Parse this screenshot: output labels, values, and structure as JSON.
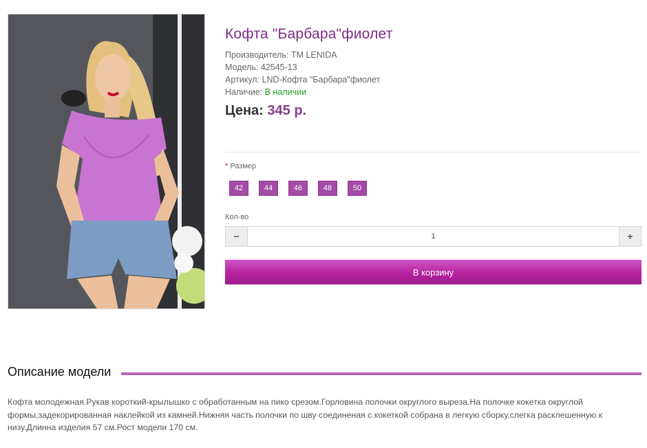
{
  "product": {
    "title": "Кофта \"Барбара\"фиолет",
    "manufacturer_label": "Производитель:",
    "manufacturer": "TM LENIDA",
    "model_label": "Модель:",
    "model": "42545-13",
    "sku_label": "Артикул:",
    "sku": "LND-Кофта \"Барбара\"фиолет",
    "stock_label": "Наличие:",
    "stock": "В наличии",
    "price_label": "Цена:",
    "price": "345 р."
  },
  "options": {
    "required_mark": "*",
    "size_label": "Размер",
    "sizes": [
      "42",
      "44",
      "46",
      "48",
      "50"
    ]
  },
  "quantity": {
    "label": "Кол-во",
    "value": "1",
    "minus": "−",
    "plus": "+"
  },
  "cart": {
    "button_label": "В корзину"
  },
  "description": {
    "heading": "Описание модели",
    "text": "Кофта молодежная.Рукав короткий-крылышко с обработанным на пико срезом.Горловина полочки округлого выреза.На полочке кокетка округлой формы,задекорированная наклейкой из камней.Нижняя часть полочки по шву соединеная с кокеткой собрана в легкую сборку,слегка расклешенную к низу.Длинна изделия 57 см.Рост модели 170 см."
  },
  "colors": {
    "title": "#7b2d84",
    "accent": "#a24aa6",
    "cart_button": "#b5229f",
    "in_stock": "#1f9a1f"
  }
}
